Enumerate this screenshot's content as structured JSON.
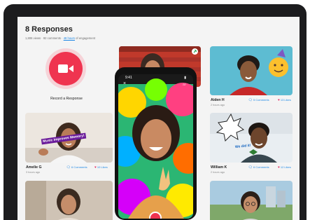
{
  "header": {
    "title": "8 Responses",
    "stats_prefix": "1,806 views · 92 comments · ",
    "stats_link": "48 hours",
    "stats_suffix": " of engagement"
  },
  "record": {
    "label": "Record a Response"
  },
  "cards": {
    "aiden": {
      "name": "Aiden H",
      "time": "2 hours ago",
      "comments": "5 Comments",
      "likes": "13 Likes"
    },
    "amelie": {
      "name": "Amelie G",
      "time": "3 hours ago",
      "comments": "6 Comments",
      "likes": "10 Likes",
      "sticker": "Music Improves Memory!"
    },
    "william": {
      "name": "William K",
      "time": "2 hours ago",
      "comments": "6 Comments",
      "likes": "12 Likes",
      "sticker": "We did it!"
    }
  },
  "phone": {
    "time": "9:41",
    "close": "×",
    "timer": ":37"
  },
  "icons": {
    "comment": "comment-icon",
    "heart": "heart-icon",
    "camera": "video-camera-icon"
  },
  "colors": {
    "accent": "#ef3450",
    "link": "#1e88e5",
    "heart": "#e0245e"
  }
}
